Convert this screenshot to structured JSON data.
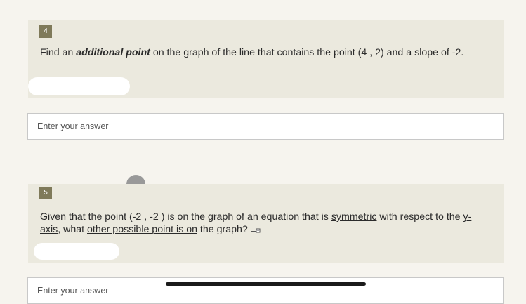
{
  "questions": [
    {
      "number": "4",
      "text_before": "Find an ",
      "text_bold": "additional point",
      "text_after": " on the graph of the line that contains the point (4 , 2) and a slope of -2.",
      "answer_placeholder": "Enter your answer"
    },
    {
      "number": "5",
      "text_a": "Given that the point (-2 , -2 ) is on the graph of an equation that is ",
      "link_symmetric": "symmetric",
      "text_b": " with respect to the ",
      "link_yaxis": "y-axis",
      "text_c": ", what ",
      "link_other": "other possible point is on",
      "text_d": " the graph?",
      "answer_placeholder": "Enter your answer"
    }
  ]
}
